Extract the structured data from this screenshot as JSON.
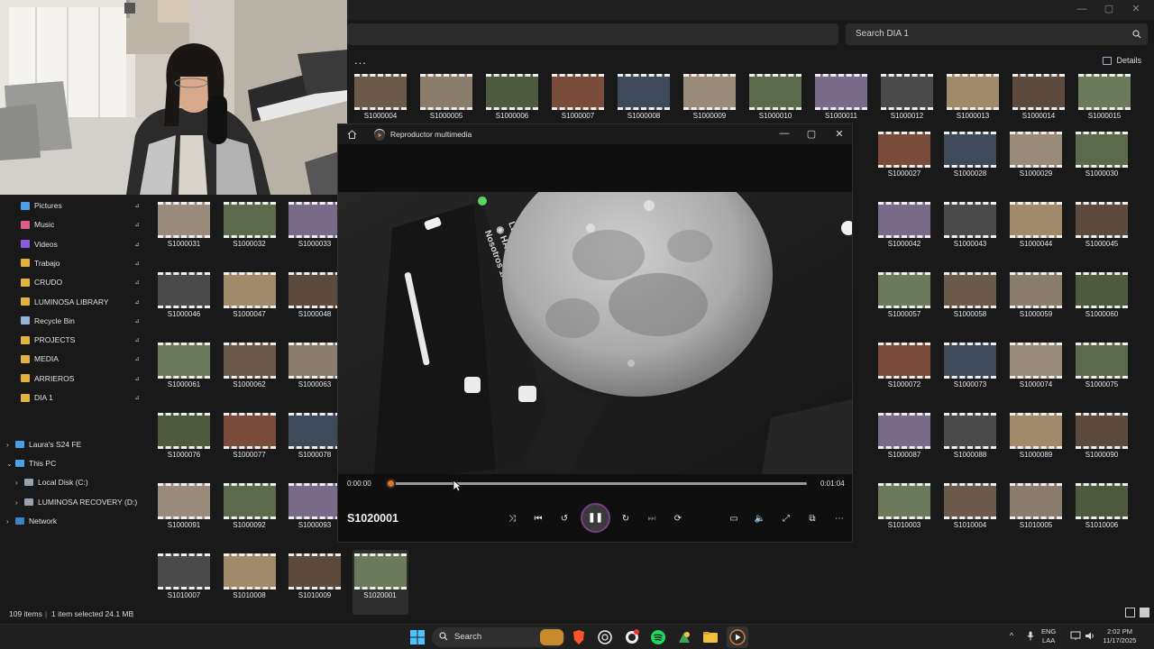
{
  "explorer": {
    "search_placeholder": "Search DIA 1",
    "toolbar": {
      "more_label": "...",
      "details_label": "Details"
    },
    "window_controls": {
      "minimize": "—",
      "maximize": "▢",
      "close": "✕"
    },
    "sidebar": {
      "quick_access": [
        {
          "label": "Pictures",
          "icon": "pictures-icon",
          "color": "#4aa0e6"
        },
        {
          "label": "Music",
          "icon": "music-icon",
          "color": "#e05a8a"
        },
        {
          "label": "Videos",
          "icon": "videos-icon",
          "color": "#8a5ae0"
        },
        {
          "label": "Trabajo",
          "icon": "folder-icon",
          "color": "#e3b23c"
        },
        {
          "label": "CRUDO",
          "icon": "folder-icon",
          "color": "#e3b23c"
        },
        {
          "label": "LUMINOSA LIBRARY",
          "icon": "folder-icon",
          "color": "#e3b23c"
        },
        {
          "label": "Recycle Bin",
          "icon": "recycle-bin-icon",
          "color": "#8fb3d9"
        },
        {
          "label": "PROJECTS",
          "icon": "folder-icon",
          "color": "#e3b23c"
        },
        {
          "label": "MEDIA",
          "icon": "folder-icon",
          "color": "#e3b23c"
        },
        {
          "label": "ARRIEROS",
          "icon": "folder-icon",
          "color": "#e3b23c"
        },
        {
          "label": "DIA 1",
          "icon": "folder-icon",
          "color": "#e3b23c"
        }
      ],
      "tree": [
        {
          "label": "Laura's S24 FE",
          "chev": "›",
          "indent": 0,
          "icon": "phone-icon"
        },
        {
          "label": "This PC",
          "chev": "⌄",
          "indent": 0,
          "icon": "pc-icon"
        },
        {
          "label": "Local Disk (C:)",
          "chev": "›",
          "indent": 1,
          "icon": "drive-icon"
        },
        {
          "label": "LUMINOSA RECOVERY (D:)",
          "chev": "›",
          "indent": 1,
          "icon": "drive-icon"
        },
        {
          "label": "Network",
          "chev": "›",
          "indent": 0,
          "icon": "network-icon"
        }
      ],
      "pin_glyph": "📌"
    },
    "thumbnails_top": [
      "S1000004",
      "S1000005",
      "S1000006",
      "S1000007",
      "S1000008",
      "S1000009",
      "S1000010",
      "S1000011",
      "S1000012",
      "S1000013",
      "S1000014",
      "S1000015"
    ],
    "thumbnails_right": [
      [
        "S1000027",
        "S1000028",
        "S1000029",
        "S1000030"
      ],
      [
        "S1000042",
        "S1000043",
        "S1000044",
        "S1000045"
      ],
      [
        "S1000057",
        "S1000058",
        "S1000059",
        "S1000060"
      ],
      [
        "S1000072",
        "S1000073",
        "S1000074",
        "S1000075"
      ],
      [
        "S1000087",
        "S1000088",
        "S1000089",
        "S1000090"
      ],
      [
        "S1010003",
        "S1010004",
        "S1010005",
        "S1010006"
      ]
    ],
    "thumbnails_left": [
      [
        "S1000031",
        "S1000032",
        "S1000033"
      ],
      [
        "S1000046",
        "S1000047",
        "S1000048"
      ],
      [
        "S1000061",
        "S1000062",
        "S1000063"
      ],
      [
        "S1000076",
        "S1000077",
        "S1000078"
      ],
      [
        "S1000091",
        "S1000092",
        "S1000093"
      ],
      [
        "S1010007",
        "S1010008",
        "S1010009",
        "S1020001"
      ]
    ],
    "status": {
      "items": "109 items",
      "selected": "1 item selected  24.1 MB"
    }
  },
  "player": {
    "title": "Reproductor multimedia",
    "filename": "S1020001",
    "time_current": "0:00:00",
    "time_total": "0:01:04",
    "progress": 0.0,
    "accent": "#d8772e",
    "controls": {
      "shuffle": "⤨",
      "previous": "⏮",
      "rewind": "↺",
      "play_pause": "❚❚",
      "forward": "↻",
      "next": "⏭",
      "repeat": "⟳",
      "captions": "▭",
      "volume": "🔈",
      "fullscreen": "⤢",
      "miniplayer": "⧉",
      "more": "⋯"
    },
    "window_controls": {
      "minimize": "—",
      "maximize": "▢",
      "close": "✕"
    },
    "overlay_text": "Luminosa · Hat-trick · Nosotros 1/04"
  },
  "taskbar": {
    "search_label": "Search",
    "lang": "ENG",
    "layout": "LAA",
    "time": "2:02 PM",
    "date": "11/17/2025",
    "tray_chevron": "^"
  }
}
